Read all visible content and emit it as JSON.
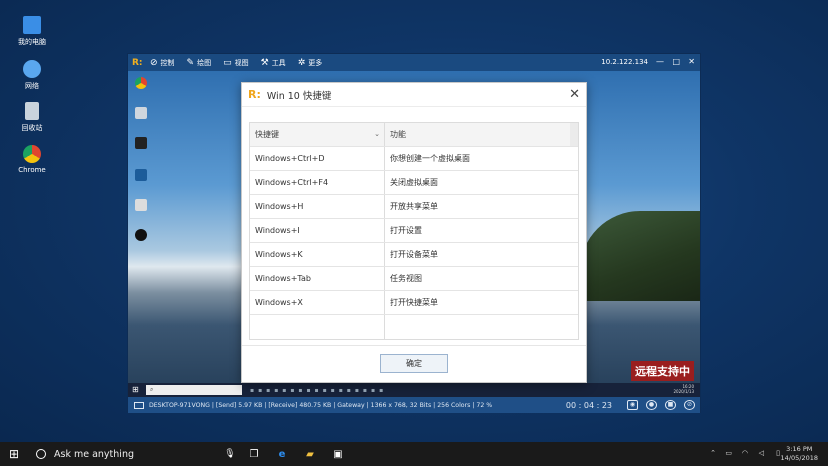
{
  "desktop": {
    "icons": [
      {
        "label": "我的电脑",
        "icon": "computer-icon",
        "color": "#3a8ee6"
      },
      {
        "label": "网络",
        "icon": "network-icon",
        "color": "#5aa7ef"
      },
      {
        "label": "回收站",
        "icon": "recycle-bin-icon",
        "color": "#c9d3dc"
      },
      {
        "label": "Chrome",
        "icon": "chrome-icon",
        "color": "#e0462f"
      }
    ]
  },
  "remote": {
    "toolbar": {
      "items": [
        {
          "label": "控制",
          "icon": "control-icon"
        },
        {
          "label": "绘图",
          "icon": "pen-icon"
        },
        {
          "label": "视图",
          "icon": "view-icon"
        },
        {
          "label": "工具",
          "icon": "tools-icon"
        },
        {
          "label": "更多",
          "icon": "more-icon"
        }
      ],
      "ip": "10.2.122.134",
      "minimize": "—",
      "restore": "□",
      "close": "✕"
    },
    "desktop_icons": [
      {
        "icon": "chrome-icon",
        "color": "#e0462f"
      },
      {
        "icon": "file-icon",
        "color": "#cfd6de"
      },
      {
        "icon": "app-icon",
        "color": "#222"
      },
      {
        "icon": "app-icon",
        "color": "#1c5c9a"
      },
      {
        "icon": "recycle-bin-icon",
        "color": "#ddd"
      },
      {
        "icon": "qq-icon",
        "color": "#111"
      }
    ],
    "taskbar": {
      "search_placeholder": "",
      "time": "16:20",
      "date": "2020/1/13"
    },
    "badge": "远程支持中",
    "status": {
      "text": "DESKTOP-971VONG | [Send] 5.97 KB | [Receive] 480.75 KB | Gateway | 1366 x 768, 32 Bits | 256 Colors | 72 %",
      "timer": "00 : 04 : 23"
    }
  },
  "dialog": {
    "title": "Win 10 快捷键",
    "headers": [
      "快捷键",
      "功能"
    ],
    "rows": [
      {
        "key": "Windows+Ctrl+D",
        "desc": "你想创建一个虚拟桌面"
      },
      {
        "key": "Windows+Ctrl+F4",
        "desc": "关闭虚拟桌面"
      },
      {
        "key": "Windows+H",
        "desc": "开放共享菜单"
      },
      {
        "key": "Windows+I",
        "desc": "打开设置"
      },
      {
        "key": "Windows+K",
        "desc": "打开设备菜单"
      },
      {
        "key": "Windows+Tab",
        "desc": "任务视图"
      },
      {
        "key": "Windows+X",
        "desc": "打开快捷菜单"
      }
    ],
    "ok_label": "确定"
  },
  "taskbar": {
    "search_label": "Ask me anything",
    "time": "3:16 PM",
    "date": "14/05/2018"
  }
}
